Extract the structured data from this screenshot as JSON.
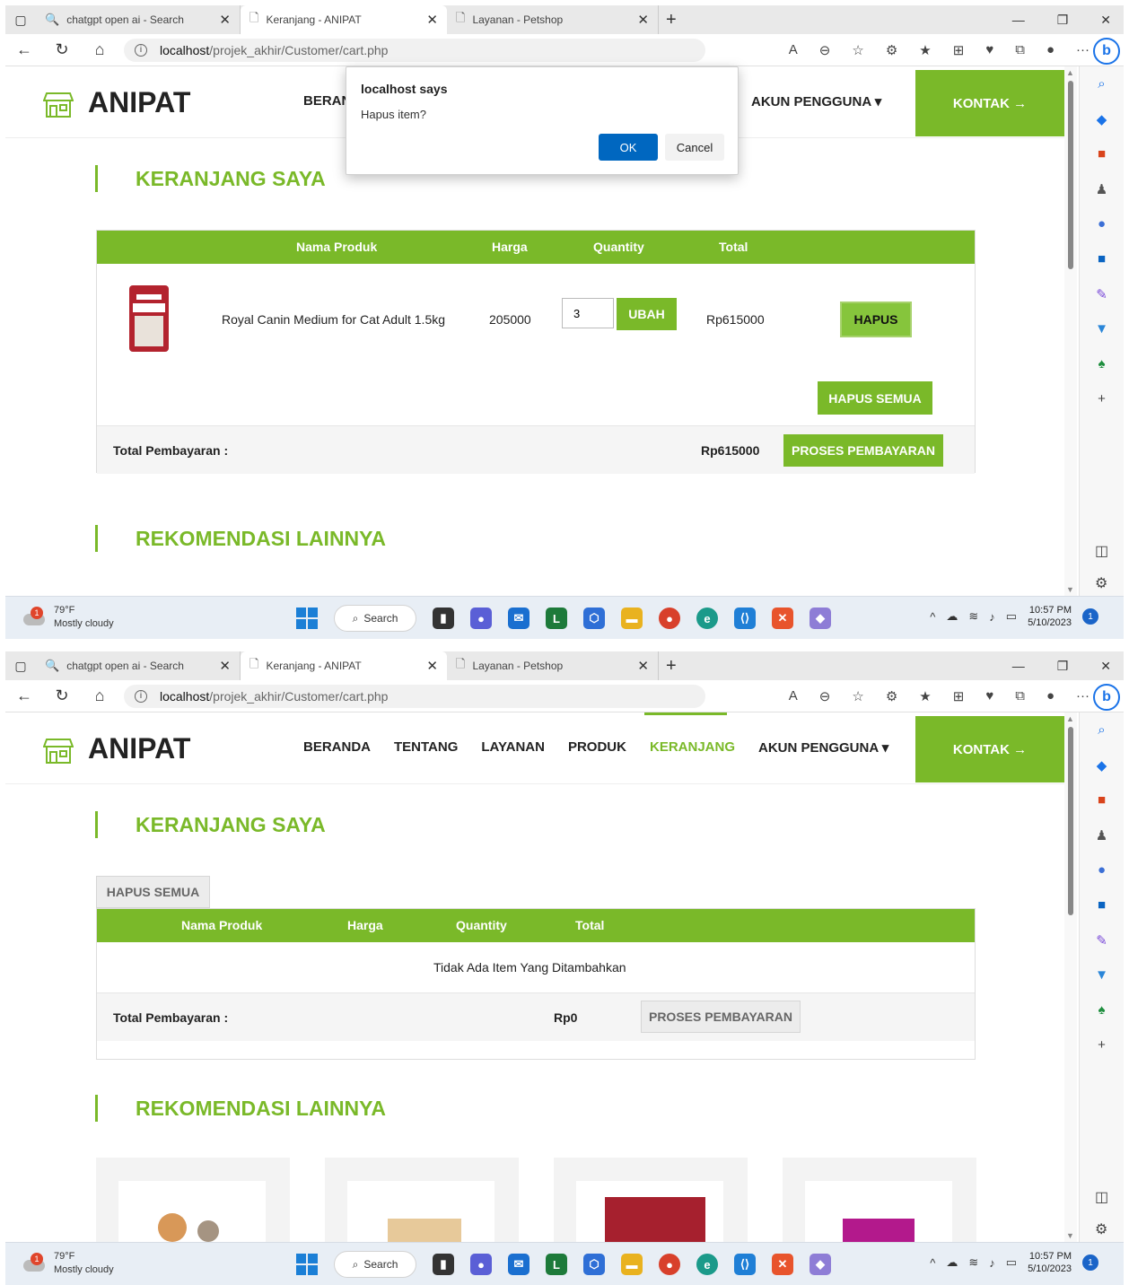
{
  "browser": {
    "tabs": [
      {
        "title": "chatgpt open ai - Search",
        "active": false
      },
      {
        "title": "Keranjang - ANIPAT",
        "active": true
      },
      {
        "title": "Layanan - Petshop",
        "active": false
      }
    ],
    "url_host": "localhost",
    "url_path": "/projek_akhir/Customer/cart.php"
  },
  "site": {
    "brand": "ANIPAT",
    "nav": [
      "BERANDA",
      "TENTANG",
      "LAYANAN",
      "PRODUK",
      "KERANJANG",
      "AKUN PENGGUNA ▾"
    ],
    "nav_active": "KERANJANG",
    "kontak": "KONTAK →",
    "cart_title": "KERANJANG SAYA",
    "reco_title": "REKOMENDASI LAINNYA",
    "cols": {
      "product": "Nama Produk",
      "price": "Harga",
      "qty": "Quantity",
      "total": "Total"
    },
    "total_label": "Total Pembayaran :",
    "checkout": "PROSES PEMBAYARAN",
    "delete_all": "HAPUS SEMUA"
  },
  "shot1": {
    "item": {
      "name": "Royal Canin Medium for Cat Adult 1.5kg",
      "price": "205000",
      "qty": "3",
      "update": "UBAH",
      "total": "Rp615000",
      "delete": "HAPUS"
    },
    "grand_total": "Rp615000",
    "dialog": {
      "title": "localhost says",
      "message": "Hapus item?",
      "ok": "OK",
      "cancel": "Cancel"
    },
    "nav_visible_partial": "BERAN"
  },
  "shot2": {
    "empty_message": "Tidak Ada Item Yang Ditambahkan",
    "grand_total": "Rp0"
  },
  "taskbar": {
    "temp": "79°F",
    "weather": "Mostly cloudy",
    "weather_badge": "1",
    "search": "Search",
    "time": "10:57 PM",
    "date": "5/10/2023",
    "notif": "1"
  },
  "colors": {
    "accent": "#7ab929",
    "dialog_ok": "#0067c0"
  }
}
